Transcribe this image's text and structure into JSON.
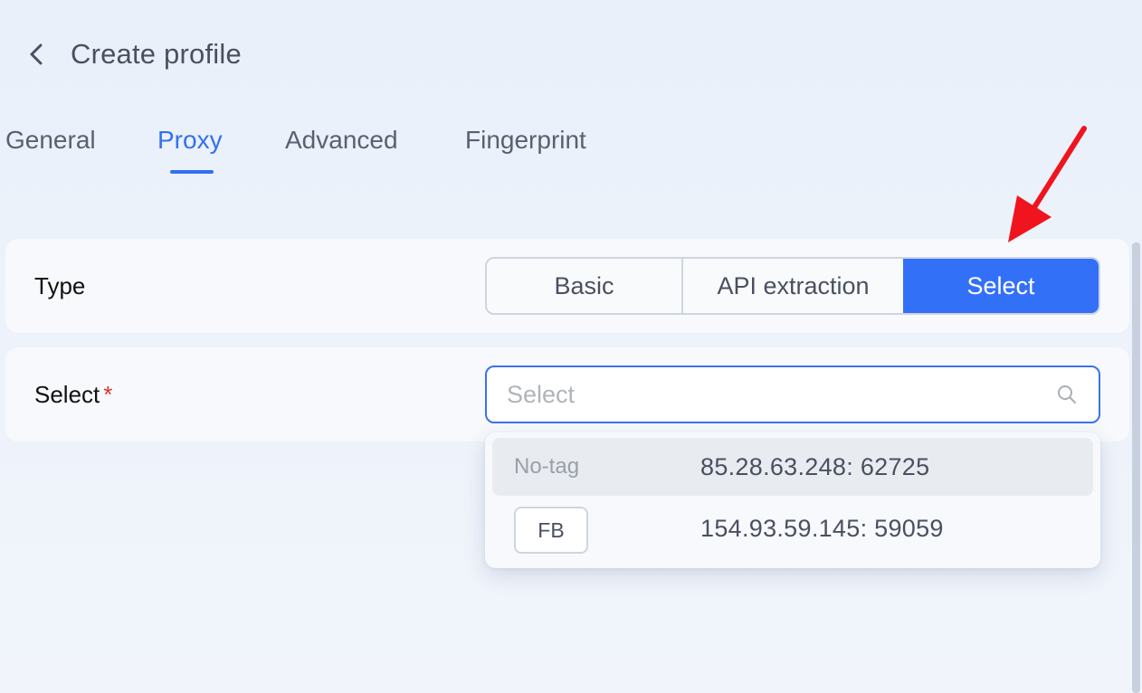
{
  "header": {
    "title": "Create profile"
  },
  "tabs": [
    {
      "label": "General"
    },
    {
      "label": "Proxy"
    },
    {
      "label": "Advanced"
    },
    {
      "label": "Fingerprint"
    }
  ],
  "active_tab": "Proxy",
  "type_row": {
    "label": "Type",
    "options": [
      {
        "label": "Basic"
      },
      {
        "label": "API extraction"
      },
      {
        "label": "Select"
      }
    ],
    "selected": "Select"
  },
  "select_row": {
    "label": "Select",
    "required_mark": "*",
    "placeholder": "Select",
    "value": ""
  },
  "dropdown": {
    "options": [
      {
        "tag": "No-tag",
        "address": "85.28.63.248: 62725"
      },
      {
        "tag": "FB",
        "address": "154.93.59.145: 59059"
      }
    ]
  },
  "colors": {
    "accent": "#3370f8",
    "required": "#e03030",
    "annotation_arrow": "#f0141e"
  },
  "icons": {
    "back": "chevron-left-icon",
    "search": "search-icon",
    "annotation": "red-arrow-annotation"
  }
}
